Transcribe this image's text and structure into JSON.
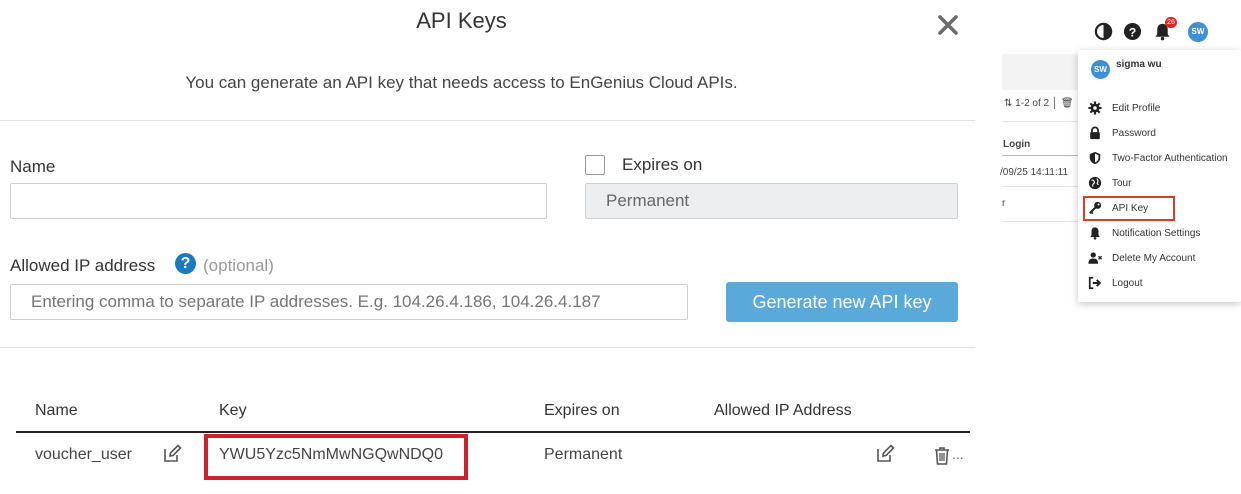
{
  "modal": {
    "title": "API Keys",
    "subtitle": "You can generate an API key that needs access to EnGenius Cloud APIs.",
    "form": {
      "name_label": "Name",
      "name_value": "",
      "expires_label": "Expires on",
      "expires_checked": false,
      "expires_value": "Permanent",
      "allowed_ip_label": "Allowed IP address",
      "allowed_ip_optional": "(optional)",
      "allowed_ip_placeholder": "Entering comma to separate IP addresses. E.g. 104.26.4.186, 104.26.4.187",
      "generate_button": "Generate new API key"
    },
    "table": {
      "columns": [
        "Name",
        "Key",
        "Expires on",
        "Allowed IP Address"
      ],
      "rows": [
        {
          "name": "voucher_user",
          "key": "YWU5Yzc5NmMwNGQwNDQ0",
          "expires": "Permanent",
          "allowed_ip": ""
        }
      ],
      "row_more": "..."
    }
  },
  "background": {
    "pagination": "1-2 of 2",
    "column_login": "Login",
    "cell_login": "/09/25 14:11:11",
    "cell_fragment": "r"
  },
  "header": {
    "notification_count": "26",
    "avatar_initials": "SW",
    "icons": [
      "contrast-icon",
      "help-icon",
      "bell-icon",
      "avatar"
    ]
  },
  "user_menu": {
    "avatar_initials": "SW",
    "user_name": "sigma wu",
    "items": [
      {
        "label": "Edit Profile",
        "icon": "gear-icon"
      },
      {
        "label": "Password",
        "icon": "lock-icon"
      },
      {
        "label": "Two-Factor Authentication",
        "icon": "shield-icon"
      },
      {
        "label": "Tour",
        "icon": "globe-icon"
      },
      {
        "label": "API Key",
        "icon": "key-icon"
      },
      {
        "label": "Notification Settings",
        "icon": "bell-icon"
      },
      {
        "label": "Delete My Account",
        "icon": "user-delete-icon"
      },
      {
        "label": "Logout",
        "icon": "logout-icon"
      }
    ]
  },
  "colors": {
    "primary_button": "#5aa9db",
    "highlight_red": "#d0202b",
    "help_blue": "#1a7bbf",
    "avatar_blue": "#3d8fd9",
    "badge_red": "#e12828"
  }
}
